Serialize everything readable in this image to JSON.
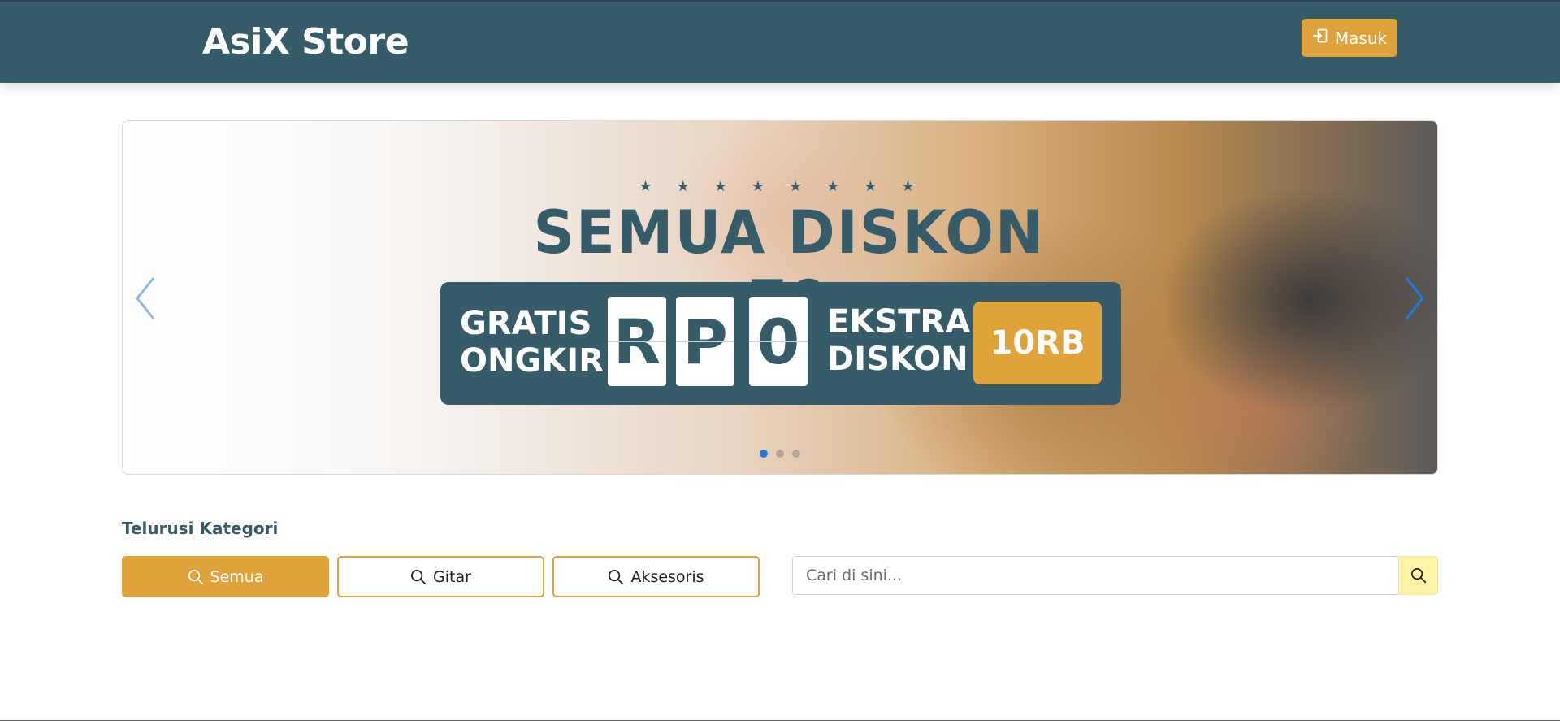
{
  "header": {
    "brand": "AsiX Store",
    "login_label": "Masuk"
  },
  "carousel": {
    "promo_title": "SEMUA DISKON 70",
    "line1_left": "GRATIS",
    "line2_left": "ONGKIR",
    "tiles": [
      "R",
      "P",
      "0"
    ],
    "line1_right": "EKSTRA",
    "line2_right": "DISKON",
    "badge": "10RB",
    "active_slide": 1,
    "slide_count": 3
  },
  "categories": {
    "title": "Telurusi Kategori",
    "items": [
      {
        "label": "Semua",
        "active": true
      },
      {
        "label": "Gitar",
        "active": false
      },
      {
        "label": "Aksesoris",
        "active": false
      }
    ]
  },
  "search": {
    "placeholder": "Cari di sini..."
  },
  "colors": {
    "primary": "#365c69",
    "accent": "#e0a23a",
    "search_button": "#fff3a8"
  },
  "icons": {
    "login": "login-icon",
    "search": "search-icon",
    "prev": "chevron-left-icon",
    "next": "chevron-right-icon"
  }
}
